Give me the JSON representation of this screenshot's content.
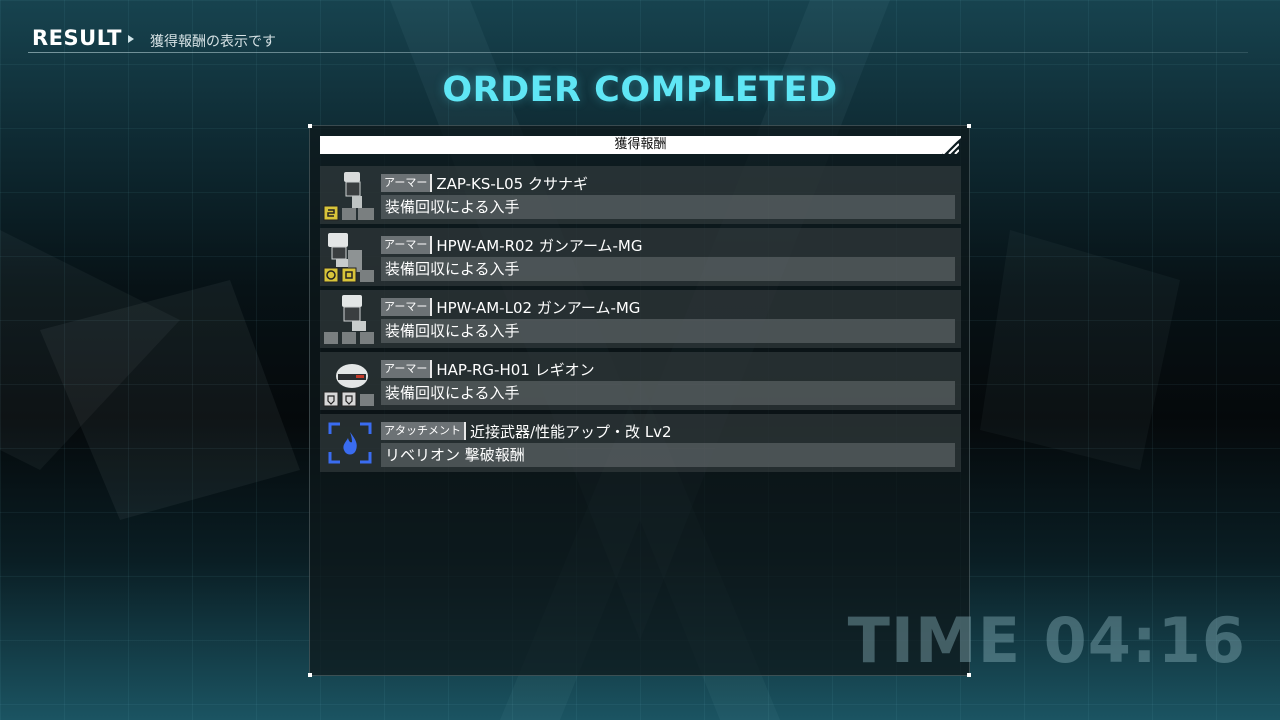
{
  "header": {
    "title": "RESULT",
    "subtitle": "獲得報酬の表示です"
  },
  "order_title": "ORDER COMPLETED",
  "panel": {
    "header_label": "獲得報酬",
    "items": [
      {
        "tag": "アーマー",
        "name": "ZAP-KS-L05 クサナギ",
        "source": "装備回収による入手",
        "icon": "leg-armor-icon"
      },
      {
        "tag": "アーマー",
        "name": "HPW-AM-R02 ガンアーム-MG",
        "source": "装備回収による入手",
        "icon": "right-arm-armor-icon"
      },
      {
        "tag": "アーマー",
        "name": "HPW-AM-L02 ガンアーム-MG",
        "source": "装備回収による入手",
        "icon": "left-arm-armor-icon"
      },
      {
        "tag": "アーマー",
        "name": "HAP-RG-H01 レギオン",
        "source": "装備回収による入手",
        "icon": "head-armor-icon"
      },
      {
        "tag": "アタッチメント",
        "name": "近接武器/性能アップ・改 Lv2",
        "source": "リベリオン 撃破報酬",
        "icon": "attachment-flame-icon"
      }
    ]
  },
  "time": "TIME 04:16",
  "colors": {
    "accent": "#5fe6f5",
    "badge_yellow": "#d8c43a",
    "attachment_blue": "#3a6cf0"
  }
}
